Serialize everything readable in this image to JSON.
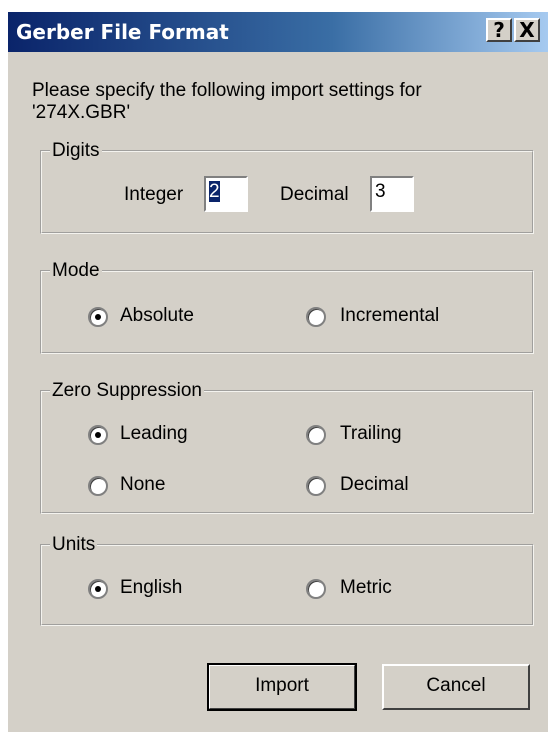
{
  "window": {
    "title": "Gerber File Format",
    "help_label": "?",
    "close_label": "X"
  },
  "prompt": {
    "line1": "Please specify the following import settings for",
    "line2": "'274X.GBR'"
  },
  "digits": {
    "legend": "Digits",
    "integer_label": "Integer",
    "integer_value": "2",
    "decimal_label": "Decimal",
    "decimal_value": "3"
  },
  "mode": {
    "legend": "Mode",
    "options": [
      {
        "label": "Absolute",
        "selected": true
      },
      {
        "label": "Incremental",
        "selected": false
      }
    ]
  },
  "zero_suppression": {
    "legend": "Zero Suppression",
    "options": [
      {
        "label": "Leading",
        "selected": true
      },
      {
        "label": "Trailing",
        "selected": false
      },
      {
        "label": "None",
        "selected": false
      },
      {
        "label": "Decimal",
        "selected": false
      }
    ]
  },
  "units": {
    "legend": "Units",
    "options": [
      {
        "label": "English",
        "selected": true
      },
      {
        "label": "Metric",
        "selected": false
      }
    ]
  },
  "buttons": {
    "import_label": "Import",
    "cancel_label": "Cancel"
  }
}
